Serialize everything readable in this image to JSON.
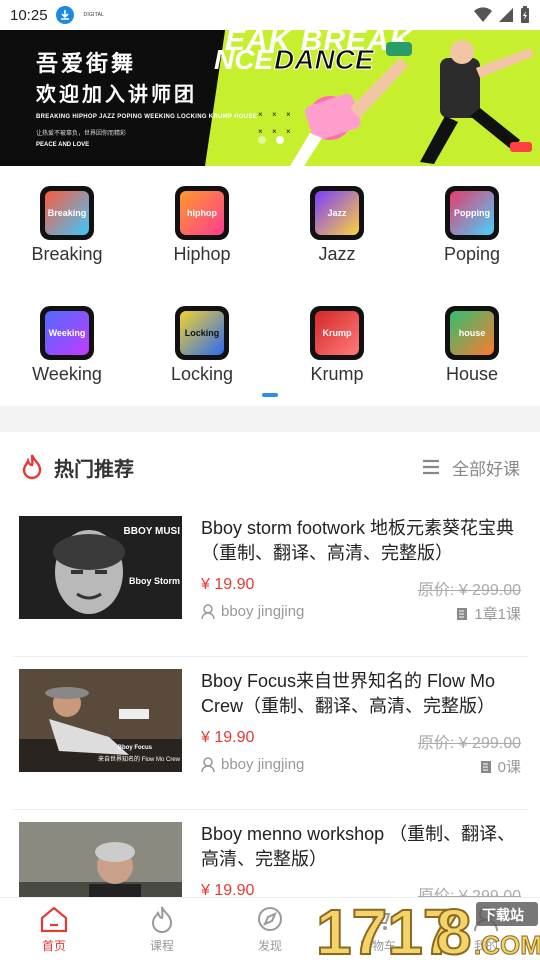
{
  "status_bar": {
    "time": "10:25",
    "mini_text": "DIGITAL"
  },
  "banner": {
    "line1": "吾爱街舞",
    "line2": "欢迎加入讲师团",
    "styles_line": "BREAKING HIPHOP JAZZ POPING WEEKING LOCKING KRUMP HOUSE",
    "slogan": "让热爱不被辜负，世界因你而精彩",
    "peace": "PEACE AND LOVE",
    "graffiti1": "EAK BREAK",
    "graffiti2": "NCE",
    "graffiti3": "DANCE"
  },
  "categories": [
    {
      "label": "Breaking",
      "icon": "breaking-icon",
      "tag": "Breaking",
      "color": "#ff5a3c"
    },
    {
      "label": "Hiphop",
      "icon": "hiphop-icon",
      "tag": "hiphop",
      "color": "#ff9a2e"
    },
    {
      "label": "Jazz",
      "icon": "jazz-icon",
      "tag": "Jazz",
      "color": "#7b3cff"
    },
    {
      "label": "Poping",
      "icon": "poping-icon",
      "tag": "Popping",
      "color": "#e83a6b"
    },
    {
      "label": "Weeking",
      "icon": "weeking-icon",
      "tag": "Weeking",
      "color": "#4d6bff"
    },
    {
      "label": "Locking",
      "icon": "locking-icon",
      "tag": "Locking",
      "color": "#f5d22b"
    },
    {
      "label": "Krump",
      "icon": "krump-icon",
      "tag": "Krump",
      "color": "#d62828"
    },
    {
      "label": "House",
      "icon": "house-icon",
      "tag": "house",
      "color": "#2fbf71"
    }
  ],
  "hot": {
    "title": "热门推荐",
    "all_label": "全部好课"
  },
  "courses": [
    {
      "title": "Bboy storm footwork 地板元素葵花宝典（重制、翻译、高清、完整版）",
      "price": "¥ 19.90",
      "original": "原价: ¥ 299.00",
      "author": "bboy jingjing",
      "chapters": "1章1课",
      "thumb_text": "BBOY MUSI",
      "thumb_sub": "Bboy Storm"
    },
    {
      "title": "Bboy Focus来自世界知名的 Flow Mo Crew（重制、翻译、高清、完整版）",
      "price": "¥ 19.90",
      "original": "原价: ¥ 299.00",
      "author": "bboy jingjing",
      "chapters": "0课",
      "thumb_text": "Bboy Focus",
      "thumb_sub": "来自世界知名的 Flow Mo Crew"
    },
    {
      "title": "Bboy menno workshop （重制、翻译、高清、完整版）",
      "price": "¥ 19.90",
      "original": "原价: ¥ 299.00",
      "author": "",
      "chapters": "",
      "thumb_text": "",
      "thumb_sub": ""
    }
  ],
  "tabs": [
    {
      "label": "首页",
      "icon": "home-icon",
      "active": true
    },
    {
      "label": "课程",
      "icon": "flame-icon",
      "active": false
    },
    {
      "label": "发现",
      "icon": "compass-icon",
      "active": false
    },
    {
      "label": "购物车",
      "icon": "cart-icon",
      "active": false
    },
    {
      "label": "我的",
      "icon": "user-icon",
      "active": false
    }
  ],
  "watermark": {
    "text1": "1717",
    "text2": "8",
    "text3": ".COM",
    "text4": "下载站"
  },
  "colors": {
    "accent": "#e53935",
    "blue": "#2d8ef0",
    "banner_green": "#c6ef2e"
  }
}
